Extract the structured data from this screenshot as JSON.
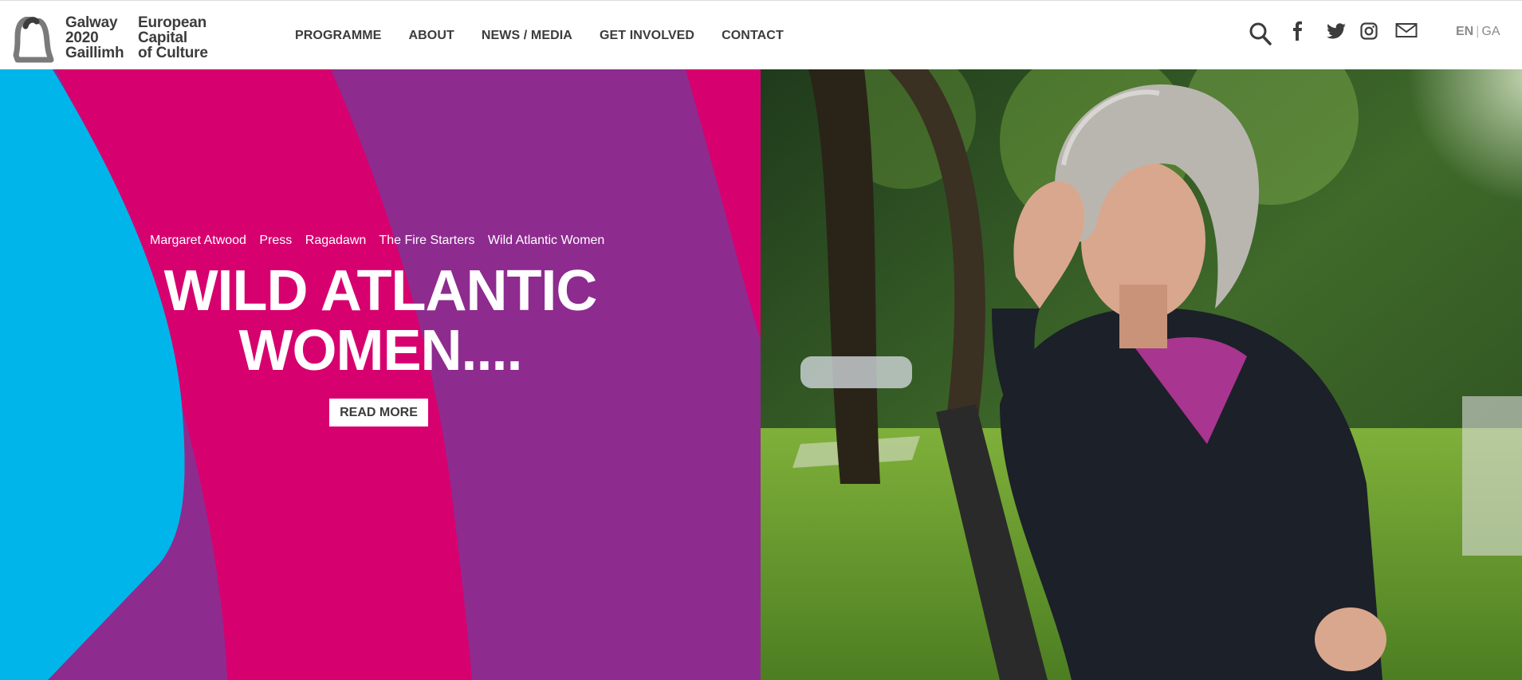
{
  "brand": {
    "line1a": "Galway",
    "line1b": "2020",
    "line1c": "Gaillimh",
    "line2a": "European",
    "line2b": "Capital",
    "line2c": "of Culture"
  },
  "nav": {
    "items": [
      "PROGRAMME",
      "ABOUT",
      "NEWS / MEDIA",
      "GET INVOLVED",
      "CONTACT"
    ]
  },
  "social": {
    "icons": [
      "search-icon",
      "facebook-icon",
      "twitter-icon",
      "instagram-icon",
      "mail-icon"
    ]
  },
  "language": {
    "active": "EN",
    "separator": "|",
    "other": "GA"
  },
  "hero": {
    "tags": [
      "Margaret Atwood",
      "Press",
      "Ragadawn",
      "The Fire Starters",
      "Wild Atlantic Women"
    ],
    "headline_line1": "WILD ATLANTIC",
    "headline_line2": "WOMEN....",
    "cta_label": "READ MORE"
  },
  "colors": {
    "cyan": "#00b5e9",
    "magenta": "#d7006f",
    "purple": "#8e2b8f",
    "text": "#3c3c3c"
  }
}
